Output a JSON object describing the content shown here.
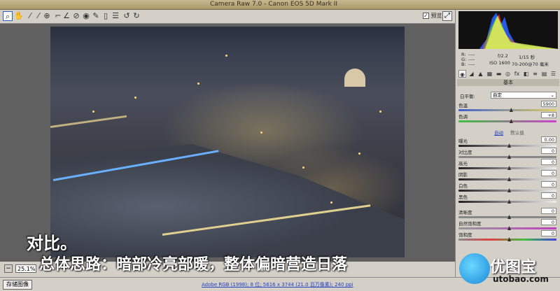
{
  "window": {
    "title": "Camera Raw 7.0 -  Canon EOS 5D Mark II"
  },
  "toolbar": {
    "tools": [
      "zoom-tool-icon",
      "hand-tool-icon",
      "white-balance-icon",
      "color-sampler-icon",
      "targeted-adjust-icon",
      "crop-icon",
      "straighten-icon",
      "spot-removal-icon",
      "red-eye-icon",
      "adjustment-brush-icon",
      "graduated-filter-icon",
      "preferences-icon",
      "rotate-left-icon",
      "rotate-right-icon"
    ],
    "preview_label": "预览",
    "preview_checked": true
  },
  "status": {
    "zoom": "25.1%"
  },
  "bottom": {
    "save_label": "存储图像",
    "workflow_link": "Adobe RGB (1998); 8 位; 5616 x 3744 (21.0 百万像素); 240 ppi"
  },
  "camera_info": {
    "r": "R:",
    "g": "G:",
    "b": "B:",
    "r_val": "----",
    "g_val": "----",
    "b_val": "----",
    "aperture": "f/2.2",
    "shutter": "1/15 秒",
    "iso": "ISO 1600",
    "lens": "70-200@70 毫米"
  },
  "panel": {
    "title": "基本",
    "white_balance": {
      "label": "白平衡:",
      "value": "自定"
    },
    "temperature": {
      "label": "色温",
      "value": "5900"
    },
    "tint": {
      "label": "色调",
      "value": "+8"
    },
    "auto_label": "自动",
    "default_label": "默认值",
    "sliders": [
      {
        "label": "曝光",
        "value": "0.00"
      },
      {
        "label": "对比度",
        "value": "0"
      },
      {
        "label": "高光",
        "value": "0"
      },
      {
        "label": "阴影",
        "value": "0"
      },
      {
        "label": "白色",
        "value": "0"
      },
      {
        "label": "黑色",
        "value": "0"
      },
      {
        "label": "清晰度",
        "value": "0"
      },
      {
        "label": "自然饱和度",
        "value": "0"
      },
      {
        "label": "饱和度",
        "value": "0"
      }
    ]
  },
  "captions": {
    "line1": "对比。",
    "line2": "总体思路：暗部冷亮部暖，整体偏暗营造日落"
  },
  "watermark": {
    "brand": "优图宝",
    "url": "utobao.com"
  }
}
